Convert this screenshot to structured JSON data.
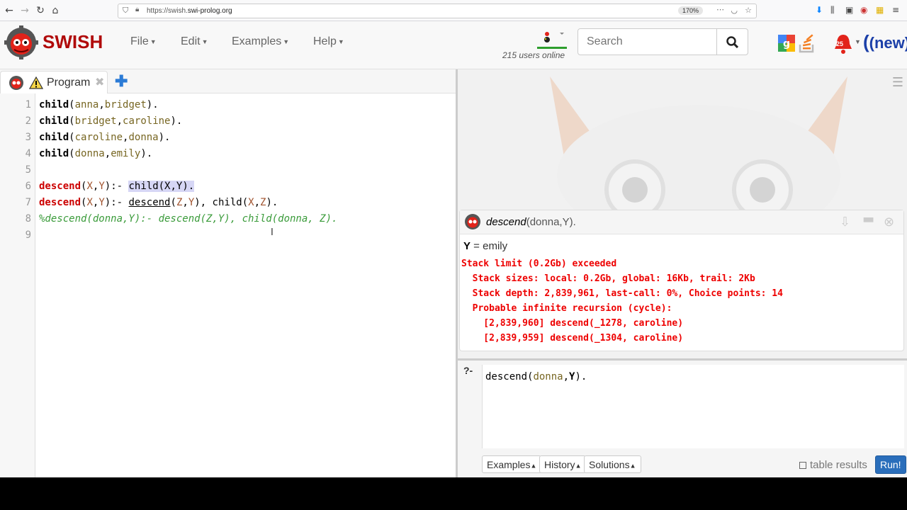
{
  "browser": {
    "url_prefix": "https://swish.",
    "url_domain": "swi-prolog.org",
    "zoom": "170%"
  },
  "header": {
    "brand": "SWISH",
    "menus": [
      "File",
      "Edit",
      "Examples",
      "Help"
    ],
    "users_online": "215 users online",
    "search_placeholder": "Search",
    "notification_count": "25",
    "new_badge": "(new)"
  },
  "program": {
    "tab_label": "Program",
    "line_numbers": [
      "1",
      "2",
      "3",
      "4",
      "5",
      "6",
      "7",
      "8",
      "9"
    ],
    "code": {
      "line1": [
        "child",
        "(",
        "anna",
        ",",
        "bridget",
        ")."
      ],
      "line2": [
        "child",
        "(",
        "bridget",
        ",",
        "caroline",
        ")."
      ],
      "line3": [
        "child",
        "(",
        "caroline",
        ",",
        "donna",
        ")."
      ],
      "line4": [
        "child",
        "(",
        "donna",
        ",",
        "emily",
        ")."
      ],
      "line6": [
        "descend",
        "(",
        "X",
        ",",
        "Y",
        "):- ",
        "child(X,Y)."
      ],
      "line7": [
        "descend",
        "(",
        "X",
        ",",
        "Y",
        "):- ",
        "descend",
        "(",
        "Z",
        ",",
        "Y",
        "), ",
        "child",
        "(",
        "X",
        ",",
        "Z",
        ")."
      ],
      "line8": "%descend(donna,Y):- descend(Z,Y), child(donna, Z)."
    }
  },
  "answer": {
    "query_name": "descend",
    "query_args": "(donna,Y).",
    "binding_var": "Y",
    "binding_value": " = emily",
    "error_lines": [
      "Stack limit (0.2Gb) exceeded",
      "  Stack sizes: local: 0.2Gb, global: 16Kb, trail: 2Kb",
      "  Stack depth: 2,839,961, last-call: 0%, Choice points: 14",
      "  Probable infinite recursion (cycle):",
      "    [2,839,960] descend(_1278, caroline)",
      "    [2,839,959] descend(_1304, caroline)"
    ]
  },
  "query": {
    "prompt": "?-",
    "code_name": "descend",
    "code_open": "(",
    "code_atom": "donna",
    "code_comma": ",",
    "code_var": "Y",
    "code_close": ").",
    "buttons": {
      "examples": "Examples",
      "history": "History",
      "solutions": "Solutions"
    },
    "table_results_label": "table results",
    "run_label": "Run!"
  }
}
